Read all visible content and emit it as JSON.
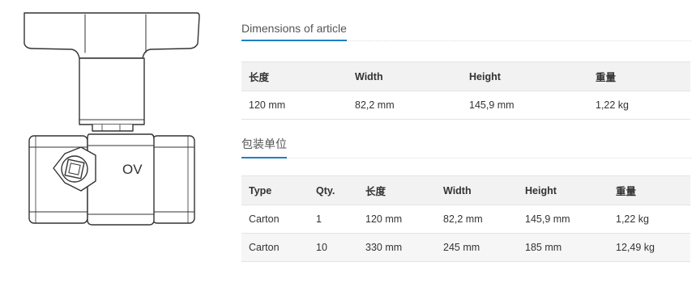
{
  "product": {
    "image_icon": "ball-valve-line-drawing",
    "valve_label": "OV"
  },
  "dimensions": {
    "title": "Dimensions of article",
    "headers": [
      "长度",
      "Width",
      "Height",
      "重量"
    ],
    "rows": [
      [
        "120 mm",
        "82,2 mm",
        "145,9 mm",
        "1,22 kg"
      ]
    ]
  },
  "packaging": {
    "title": "包装单位",
    "headers": [
      "Type",
      "Qty.",
      "长度",
      "Width",
      "Height",
      "重量"
    ],
    "rows": [
      [
        "Carton",
        "1",
        "120 mm",
        "82,2 mm",
        "145,9 mm",
        "1,22 kg"
      ],
      [
        "Carton",
        "10",
        "330 mm",
        "245 mm",
        "185 mm",
        "12,49 kg"
      ]
    ]
  },
  "colors": {
    "accent": "#1f7fc1",
    "header_bg": "#f2f2f2",
    "border": "#e3e3e3"
  }
}
